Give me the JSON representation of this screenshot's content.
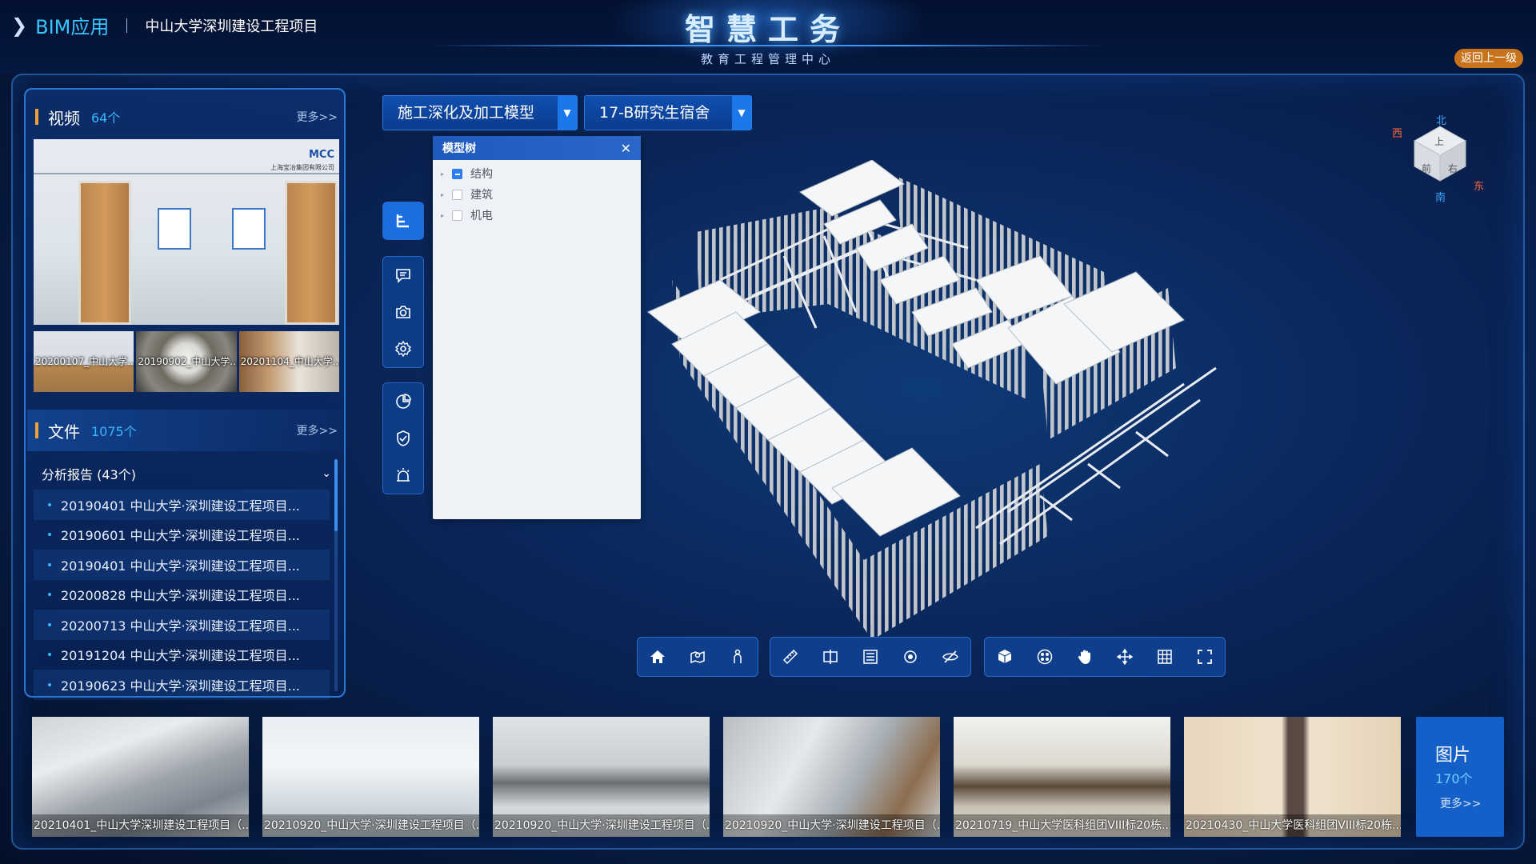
{
  "header": {
    "app_title": "BIM应用",
    "project": "中山大学深圳建设工程项目",
    "hero_title": "智慧工务",
    "hero_subtitle": "教育工程管理中心",
    "back_label": "返回上一级"
  },
  "videos": {
    "label": "视频",
    "count": "64个",
    "more": "更多>>",
    "main_logo": "MCC",
    "main_logo_sub": "上海宝冶集团有限公司",
    "thumbs": [
      "20200107_中山大学...",
      "20190902_中山大学...",
      "20201104_中山大学..."
    ]
  },
  "files": {
    "label": "文件",
    "count": "1075个",
    "more": "更多>>",
    "category": "分析报告 (43个)",
    "items": [
      "20190401  中山大学·深圳建设工程项目...",
      "20190601  中山大学·深圳建设工程项目...",
      "20190401  中山大学·深圳建设工程项目...",
      "20200828  中山大学·深圳建设工程项目...",
      "20200713  中山大学·深圳建设工程项目...",
      "20191204  中山大学·深圳建设工程项目...",
      "20190623  中山大学·深圳建设工程项目..."
    ]
  },
  "selectors": {
    "model_type": "施工深化及加工模型",
    "building": "17-B研究生宿舍"
  },
  "model_tree": {
    "title": "模型树",
    "items": [
      {
        "label": "结构",
        "checked": true
      },
      {
        "label": "建筑",
        "checked": false
      },
      {
        "label": "机电",
        "checked": false
      }
    ]
  },
  "compass": {
    "north": "北",
    "south": "南",
    "east": "东",
    "west": "西",
    "top": "上",
    "front": "前",
    "right": "右"
  },
  "vertical_toolbar": [
    "tree-icon",
    "comment-icon",
    "camera-icon",
    "settings-icon",
    "pie-chart-icon",
    "shield-icon",
    "alarm-icon"
  ],
  "bottom_toolbar": [
    "home-icon",
    "map-pin-icon",
    "person-icon",
    "ruler-icon",
    "section-icon",
    "list-icon",
    "target-icon",
    "hide-icon",
    "cube-icon",
    "cluster-icon",
    "hand-icon",
    "rotate-icon",
    "grid-icon",
    "fullscreen-icon"
  ],
  "gallery": {
    "items": [
      "20210401_中山大学深圳建设工程项目（...",
      "20210920_中山大学·深圳建设工程项目（...",
      "20210920_中山大学·深圳建设工程项目（...",
      "20210920_中山大学·深圳建设工程项目（...",
      "20210719_中山大学医科组团VIII标20栋...",
      "20210430_中山大学医科组团VIII标20栋..."
    ],
    "card_title": "图片",
    "card_count": "170个",
    "card_more": "更多>>"
  },
  "colors": {
    "accent": "#36b8ff",
    "highlight": "#f0a23a",
    "back_button": "#c8731c",
    "panel_border": "#2a78d6"
  }
}
